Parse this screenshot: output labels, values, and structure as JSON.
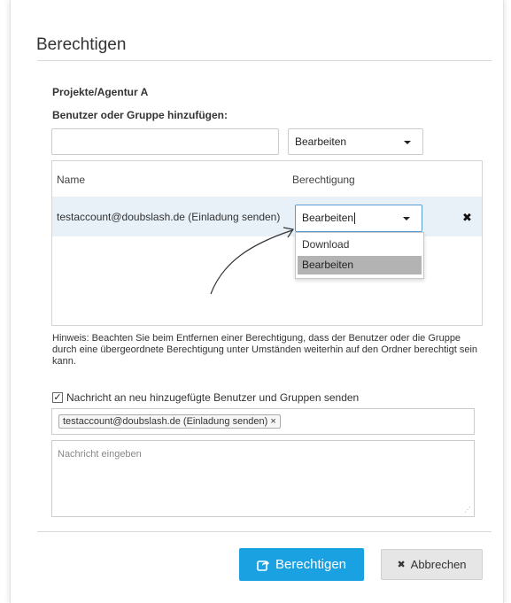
{
  "dialog": {
    "title": "Berechtigen",
    "path_label": "Projekte/Agentur A",
    "add_label": "Benutzer oder Gruppe hinzufügen:",
    "add_input_value": "",
    "add_select_value": "Bearbeiten"
  },
  "table": {
    "headers": [
      "Name",
      "Berechtigung"
    ],
    "rows": [
      {
        "name": "testaccount@doubslash.de (Einladung senden)",
        "permission": "Bearbeiten",
        "remove_glyph": "✖"
      }
    ],
    "dropdown_options": [
      {
        "label": "Download",
        "selected": false
      },
      {
        "label": "Bearbeiten",
        "selected": true
      }
    ]
  },
  "hint": "Hinweis: Beachten Sie beim Entfernen einer Berechtigung, dass der Benutzer oder die Gruppe durch eine übergeordnete Berechtigung unter Umständen weiterhin auf den Ordner berechtigt sein kann.",
  "notify": {
    "checked": true,
    "check_glyph": "✓",
    "label": "Nachricht an neu hinzugefügte Benutzer und Gruppen senden",
    "tags": [
      {
        "label": "testaccount@doubslash.de (Einladung senden)",
        "remove_glyph": "×"
      }
    ],
    "message_placeholder": "Nachricht eingeben"
  },
  "footer": {
    "confirm_label": "Berechtigen",
    "cancel_label": "Abbrechen",
    "cancel_glyph": "✖"
  },
  "colors": {
    "primary": "#1aa1e1",
    "row_highlight": "#e8f0f8",
    "option_selected": "#b3b3b3",
    "focus_border": "#5b9bd5"
  },
  "icons": {
    "confirm": "share-square-icon",
    "cancel": "times-icon",
    "remove_row": "times-icon",
    "caret": "caret-down-icon"
  }
}
